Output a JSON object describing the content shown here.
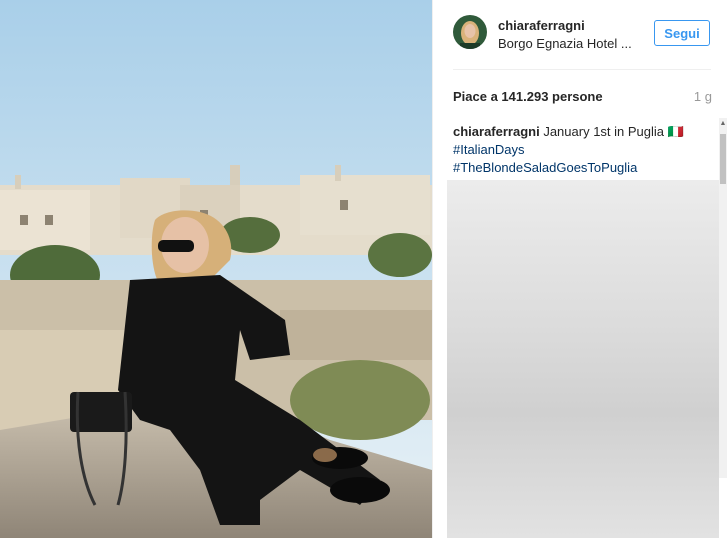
{
  "post": {
    "image_alt": "Woman in black outfit sitting on a stone wall at Borgo Egnazia"
  },
  "header": {
    "username": "chiaraferragni",
    "location": "Borgo Egnazia Hotel ...",
    "follow_label": "Segui"
  },
  "stats": {
    "likes": "Piace a 141.293 persone",
    "time": "1 g"
  },
  "caption": {
    "username": "chiaraferragni",
    "text": "January 1st in Puglia 🇮🇹",
    "hashtags": [
      "#ItalianDays",
      "#TheBlondeSaladGoesToPuglia"
    ]
  },
  "colors": {
    "accent": "#3897f0",
    "hashtag": "#003569"
  }
}
